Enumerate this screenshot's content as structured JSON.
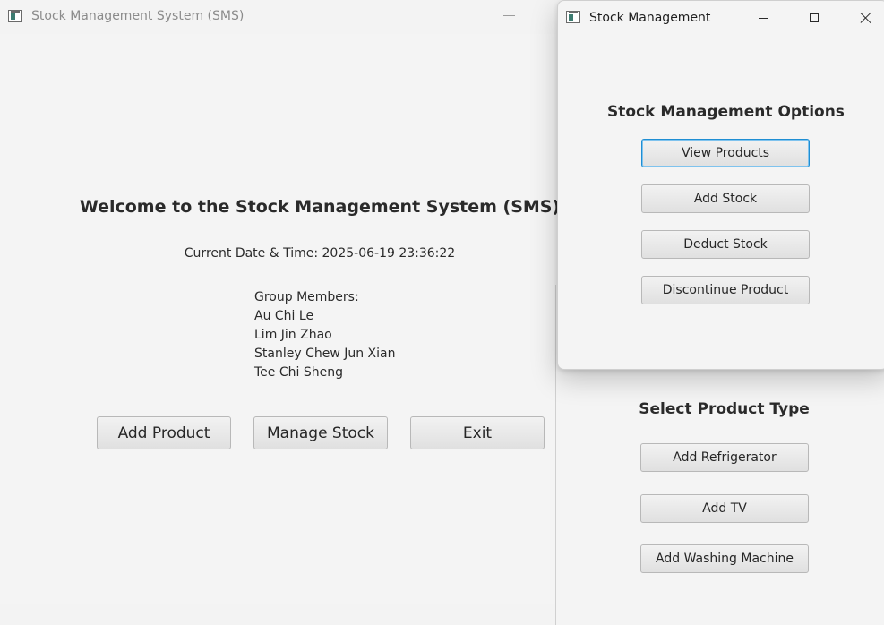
{
  "main_window": {
    "title": "Stock Management System (SMS)",
    "welcome": "Welcome to the Stock Management System (SMS)",
    "datetime": "Current Date & Time: 2025-06-19 23:36:22",
    "members_heading": "Group Members:",
    "members": [
      "Au Chi Le",
      "Lim Jin Zhao",
      "Stanley Chew Jun Xian",
      "Tee Chi Sheng"
    ],
    "buttons": {
      "add_product": "Add Product",
      "manage_stock": "Manage Stock",
      "exit": "Exit"
    }
  },
  "product_type_window": {
    "heading": "Select Product Type",
    "buttons": {
      "refrigerator": "Add Refrigerator",
      "tv": "Add TV",
      "washing_machine": "Add Washing Machine"
    }
  },
  "stock_window": {
    "title": "Stock Management",
    "heading": "Stock Management Options",
    "buttons": {
      "view_products": "View Products",
      "add_stock": "Add Stock",
      "deduct_stock": "Deduct Stock",
      "discontinue_product": "Discontinue Product"
    },
    "focused_button": "view_products"
  },
  "icons": {
    "app": "java-app-icon",
    "minimize": "minimize-icon",
    "maximize": "maximize-icon",
    "close": "close-icon"
  },
  "colors": {
    "window_bg": "#f4f4f4",
    "focus_border": "#1f8ed3",
    "title_inactive": "#8b8b8b"
  }
}
